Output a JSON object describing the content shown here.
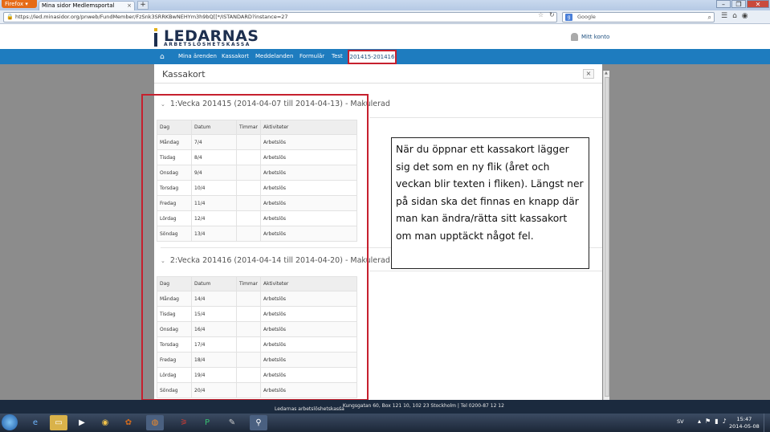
{
  "browser": {
    "firefox_label": "Firefox ▾",
    "tab_title": "Mina sidor Medlemsportal",
    "new_tab": "+",
    "url": "https://led.minasidor.org/pnweb/FundMember/FzSnk3SRRKBwNEHYm3h9bQ[[*/ISTANDARD?instance=27",
    "search_placeholder": "Google",
    "search_engine_icon": "google-icon"
  },
  "site": {
    "logo_main": "LEDARNAS",
    "logo_sub": "ARBETSLÖSHETSKASSA",
    "my_account": "Mitt konto"
  },
  "menu": {
    "items": [
      "Mina ärenden",
      "Kassakort",
      "Meddelanden",
      "Formulär",
      "Test"
    ],
    "active_tab": "201415-201416"
  },
  "modal": {
    "title": "Kassakort",
    "close": "×"
  },
  "columns": [
    "Dag",
    "Datum",
    "Timmar",
    "Aktiviteter"
  ],
  "weeks": [
    {
      "title": "1:Vecka 201415 (2014-04-07 till 2014-04-13) - Makulerad",
      "rows": [
        {
          "dag": "Måndag",
          "datum": "7/4",
          "timmar": "",
          "aktivitet": "Arbetslös"
        },
        {
          "dag": "Tisdag",
          "datum": "8/4",
          "timmar": "",
          "aktivitet": "Arbetslös"
        },
        {
          "dag": "Onsdag",
          "datum": "9/4",
          "timmar": "",
          "aktivitet": "Arbetslös"
        },
        {
          "dag": "Torsdag",
          "datum": "10/4",
          "timmar": "",
          "aktivitet": "Arbetslös"
        },
        {
          "dag": "Fredag",
          "datum": "11/4",
          "timmar": "",
          "aktivitet": "Arbetslös"
        },
        {
          "dag": "Lördag",
          "datum": "12/4",
          "timmar": "",
          "aktivitet": "Arbetslös"
        },
        {
          "dag": "Söndag",
          "datum": "13/4",
          "timmar": "",
          "aktivitet": "Arbetslös"
        }
      ]
    },
    {
      "title": "2:Vecka 201416 (2014-04-14 till 2014-04-20) - Makulerad",
      "rows": [
        {
          "dag": "Måndag",
          "datum": "14/4",
          "timmar": "",
          "aktivitet": "Arbetslös"
        },
        {
          "dag": "Tisdag",
          "datum": "15/4",
          "timmar": "",
          "aktivitet": "Arbetslös"
        },
        {
          "dag": "Onsdag",
          "datum": "16/4",
          "timmar": "",
          "aktivitet": "Arbetslös"
        },
        {
          "dag": "Torsdag",
          "datum": "17/4",
          "timmar": "",
          "aktivitet": "Arbetslös"
        },
        {
          "dag": "Fredag",
          "datum": "18/4",
          "timmar": "",
          "aktivitet": "Arbetslös"
        },
        {
          "dag": "Lördag",
          "datum": "19/4",
          "timmar": "",
          "aktivitet": "Arbetslös"
        },
        {
          "dag": "Söndag",
          "datum": "20/4",
          "timmar": "",
          "aktivitet": "Arbetslös"
        }
      ]
    }
  ],
  "callout": "När du öppnar ett kassakort lägger sig det som en ny flik (året och veckan blir texten i fliken). Längst ner på sidan ska det finnas en knapp där man kan ändra/rätta sitt kassakort om man upptäckt något fel.",
  "footer": {
    "org": "Ledarnas arbetslöshetskassa",
    "address": ", Kungsgatan 60, Box 121 10, 102 23 Stockholm | Tel 0200-87 12 12"
  },
  "taskbar": {
    "lang": "SV",
    "time": "15:47",
    "date": "2014-05-08"
  },
  "colors": {
    "menu_bar": "#1e7cbf",
    "highlight": "#c6202e",
    "footer": "#1b2a3e"
  }
}
